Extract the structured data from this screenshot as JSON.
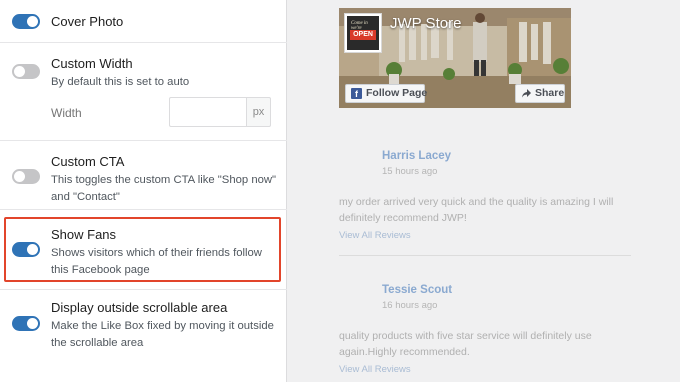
{
  "settings": {
    "cover_photo": {
      "title": "Cover Photo",
      "enabled": true
    },
    "custom_width": {
      "title": "Custom Width",
      "description": "By default this is set to auto",
      "enabled": false,
      "width_label": "Width",
      "width_value": "",
      "width_unit": "px"
    },
    "custom_cta": {
      "title": "Custom CTA",
      "description": "This toggles the custom CTA like \"Shop now\" and \"Contact\"",
      "enabled": false
    },
    "show_fans": {
      "title": "Show Fans",
      "description": "Shows visitors which of their friends follow this Facebook page",
      "enabled": true,
      "highlighted": true
    },
    "outside_scrollable": {
      "title": "Display outside scrollable area",
      "description": "Make the Like Box fixed by moving it outside the scrollable area",
      "enabled": true
    }
  },
  "preview": {
    "page_name": "JWP Store",
    "thumb_sign": "OPEN",
    "thumb_small_text": "Come in we're",
    "follow_label": "Follow Page",
    "share_label": "Share",
    "reviews": [
      {
        "name": "Harris Lacey",
        "time": "15 hours ago",
        "text": "my order arrived very quick and the quality is amazing I will definitely recommend JWP!",
        "link": "View All Reviews"
      },
      {
        "name": "Tessie Scout",
        "time": "16 hours ago",
        "text": "quality products with five star service will definitely use again.Highly recommended.",
        "link": "View All Reviews"
      }
    ]
  },
  "colors": {
    "toggle_on": "#2f73b6",
    "toggle_off": "#c5c5c7",
    "highlight_border": "#e2452b",
    "facebook_blue": "#3b5998"
  }
}
